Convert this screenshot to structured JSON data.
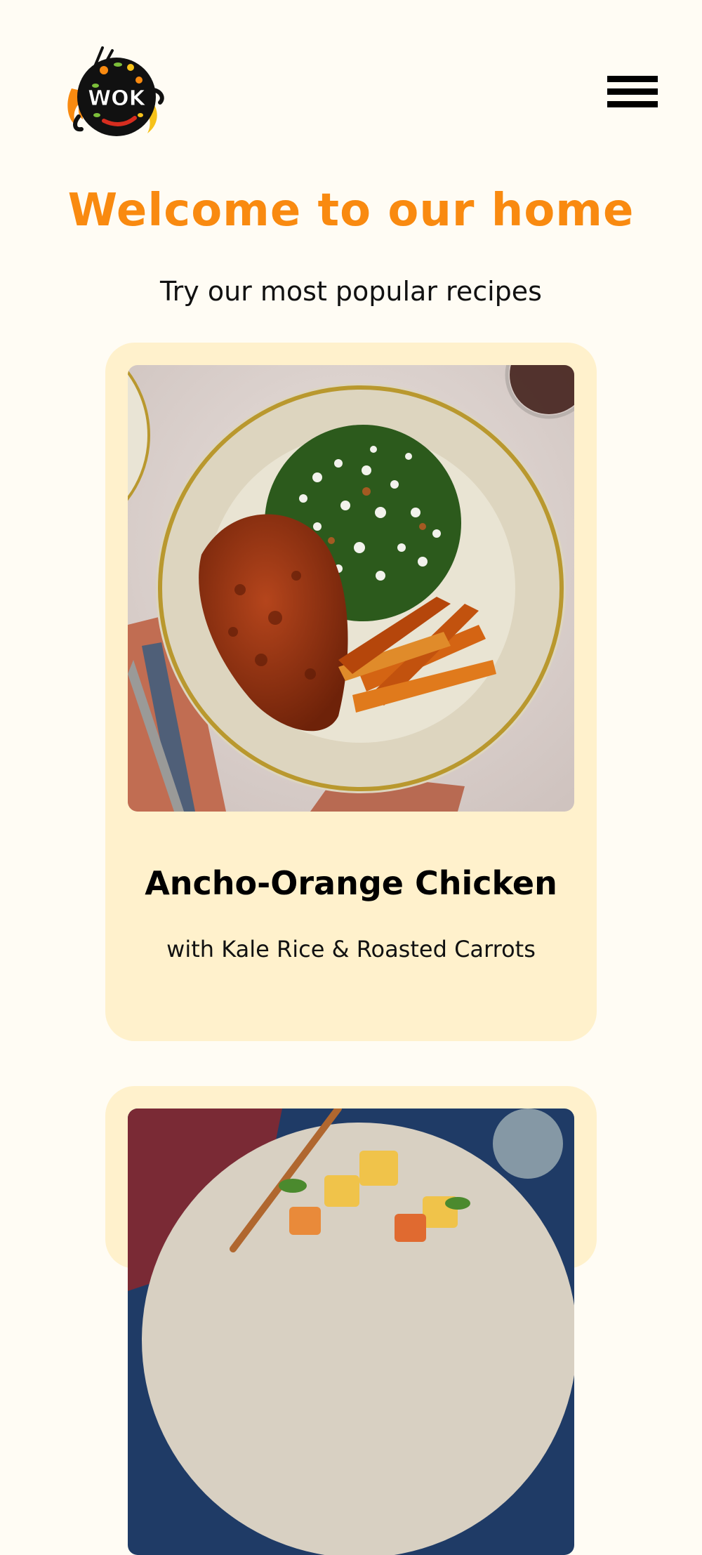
{
  "header": {
    "logo_text": "WOK",
    "menu_icon": "hamburger-menu-icon"
  },
  "hero": {
    "title": "Welcome to our home",
    "subtitle": "Try our most popular recipes"
  },
  "recipes": [
    {
      "title": "Ancho-Orange Chicken",
      "description": "with Kale Rice & Roasted Carrots",
      "image_subject": "chicken-plate-image"
    },
    {
      "title": "",
      "description": "",
      "image_subject": "potato-bowl-image"
    }
  ],
  "colors": {
    "background": "#fffcf4",
    "accent": "#f98a10",
    "card": "#fff1cc"
  }
}
